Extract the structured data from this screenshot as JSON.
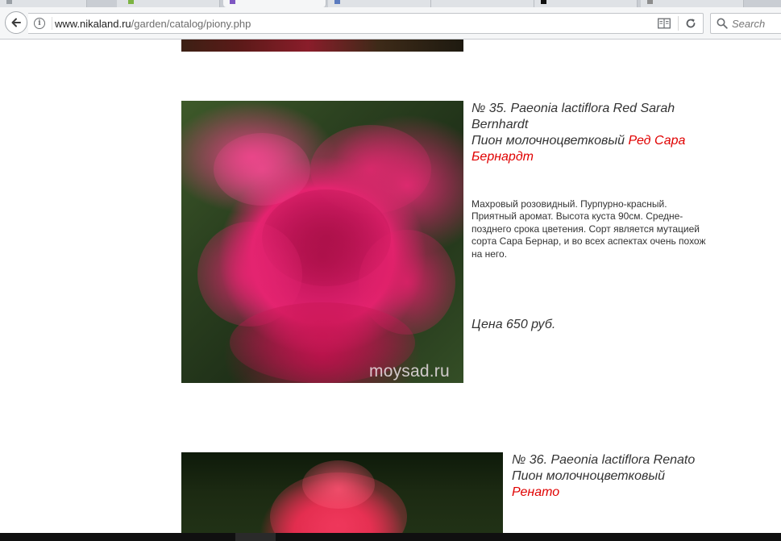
{
  "browser": {
    "url_host": "www.nikaland.ru",
    "url_path": "/garden/catalog/piony.php",
    "search_placeholder": "Search"
  },
  "products": [
    {
      "number_label": "№ 35.",
      "latin_name": "Paeonia lactiflora Red Sarah Bernhardt",
      "ru_prefix": "Пион молочноцветковый",
      "ru_name": "Ред Сара Бернардт",
      "description": "Махровый розовидный. Пурпурно-красный. Приятный аромат. Высота куста 90см. Средне-позднего срока цветения. Сорт является мутацией сорта Сара Бернар, и во всех аспектах очень похож на него.",
      "price": "Цена 650 руб.",
      "watermark": "moysad.ru"
    },
    {
      "number_label": "№ 36.",
      "latin_name": "Paeonia lactiflora Renato",
      "ru_prefix": "Пион молочноцветковый",
      "ru_name": "Ренато"
    }
  ],
  "colors": {
    "accent_red": "#e00000",
    "text": "#333333"
  }
}
